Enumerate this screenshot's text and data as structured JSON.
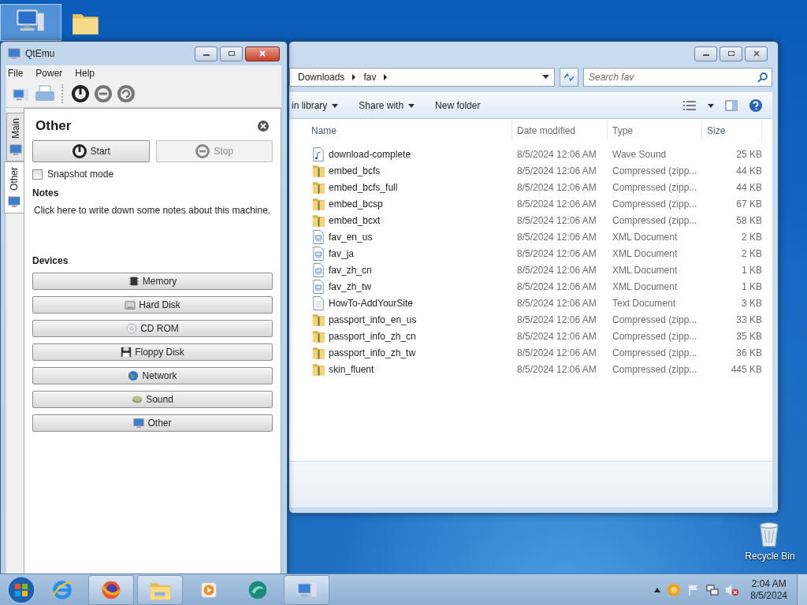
{
  "desktop_icons": [
    {
      "kind": "computer",
      "selected": true
    },
    {
      "kind": "folder",
      "selected": false
    },
    {
      "kind": "recycle",
      "label": "Recycle Bin",
      "selected": false
    }
  ],
  "explorer": {
    "breadcrumb": [
      "Downloads",
      "fav"
    ],
    "search": {
      "placeholder": "Search fav"
    },
    "toolbar": [
      {
        "label": "in library",
        "dropdown": true
      },
      {
        "label": "Share with",
        "dropdown": true
      },
      {
        "label": "New folder",
        "dropdown": false
      }
    ],
    "columns": [
      "Name",
      "Date modified",
      "Type",
      "Size"
    ],
    "files": [
      {
        "kind": "audio",
        "name": "download-complete",
        "date": "8/5/2024 12:06 AM",
        "type": "Wave Sound",
        "size": "25 KB"
      },
      {
        "kind": "zip",
        "name": "embed_bcfs",
        "date": "8/5/2024 12:06 AM",
        "type": "Compressed (zipp...",
        "size": "44 KB"
      },
      {
        "kind": "zip",
        "name": "embed_bcfs_full",
        "date": "8/5/2024 12:06 AM",
        "type": "Compressed (zipp...",
        "size": "44 KB"
      },
      {
        "kind": "zip",
        "name": "embed_bcsp",
        "date": "8/5/2024 12:06 AM",
        "type": "Compressed (zipp...",
        "size": "67 KB"
      },
      {
        "kind": "zip",
        "name": "embed_bcxt",
        "date": "8/5/2024 12:06 AM",
        "type": "Compressed (zipp...",
        "size": "58 KB"
      },
      {
        "kind": "xml",
        "name": "fav_en_us",
        "date": "8/5/2024 12:06 AM",
        "type": "XML Document",
        "size": "2 KB"
      },
      {
        "kind": "xml",
        "name": "fav_ja",
        "date": "8/5/2024 12:06 AM",
        "type": "XML Document",
        "size": "2 KB"
      },
      {
        "kind": "xml",
        "name": "fav_zh_cn",
        "date": "8/5/2024 12:06 AM",
        "type": "XML Document",
        "size": "1 KB"
      },
      {
        "kind": "xml",
        "name": "fav_zh_tw",
        "date": "8/5/2024 12:06 AM",
        "type": "XML Document",
        "size": "1 KB"
      },
      {
        "kind": "text",
        "name": "HowTo-AddYourSite",
        "date": "8/5/2024 12:06 AM",
        "type": "Text Document",
        "size": "3 KB"
      },
      {
        "kind": "zip",
        "name": "passport_info_en_us",
        "date": "8/5/2024 12:06 AM",
        "type": "Compressed (zipp...",
        "size": "33 KB"
      },
      {
        "kind": "zip",
        "name": "passport_info_zh_cn",
        "date": "8/5/2024 12:06 AM",
        "type": "Compressed (zipp...",
        "size": "35 KB"
      },
      {
        "kind": "zip",
        "name": "passport_info_zh_tw",
        "date": "8/5/2024 12:06 AM",
        "type": "Compressed (zipp...",
        "size": "36 KB"
      },
      {
        "kind": "zip",
        "name": "skin_fluent",
        "date": "8/5/2024 12:06 AM",
        "type": "Compressed (zipp...",
        "size": "445 KB"
      }
    ]
  },
  "qtemu": {
    "title": "QtEmu",
    "menu": [
      "File",
      "Power",
      "Help"
    ],
    "tabs": [
      {
        "label": "Main",
        "selected": false
      },
      {
        "label": "Other",
        "selected": true
      }
    ],
    "heading": "Other",
    "actions": [
      {
        "kind": "start",
        "label": "Start",
        "disabled": false
      },
      {
        "kind": "stop",
        "label": "Stop",
        "disabled": true
      }
    ],
    "snapshot": {
      "label": "Snapshot mode",
      "checked": false
    },
    "notes_heading": "Notes",
    "notes": "Click here to write down some notes about this machine.",
    "devices_heading": "Devices",
    "devices": [
      {
        "kind": "memory",
        "label": "Memory"
      },
      {
        "kind": "disk",
        "label": "Hard Disk"
      },
      {
        "kind": "cd",
        "label": "CD ROM"
      },
      {
        "kind": "floppy",
        "label": "Floppy Disk"
      },
      {
        "kind": "network",
        "label": "Network"
      },
      {
        "kind": "sound",
        "label": "Sound"
      },
      {
        "kind": "other",
        "label": "Other"
      }
    ]
  },
  "taskbar": {
    "apps": [
      {
        "kind": "ie",
        "active": false
      },
      {
        "kind": "firefox",
        "active": true
      },
      {
        "kind": "explorer",
        "active": true
      },
      {
        "kind": "media",
        "active": false
      },
      {
        "kind": "app",
        "active": false
      },
      {
        "kind": "qtemu",
        "active": true
      }
    ],
    "time": "2:04 AM",
    "date": "8/5/2024"
  }
}
